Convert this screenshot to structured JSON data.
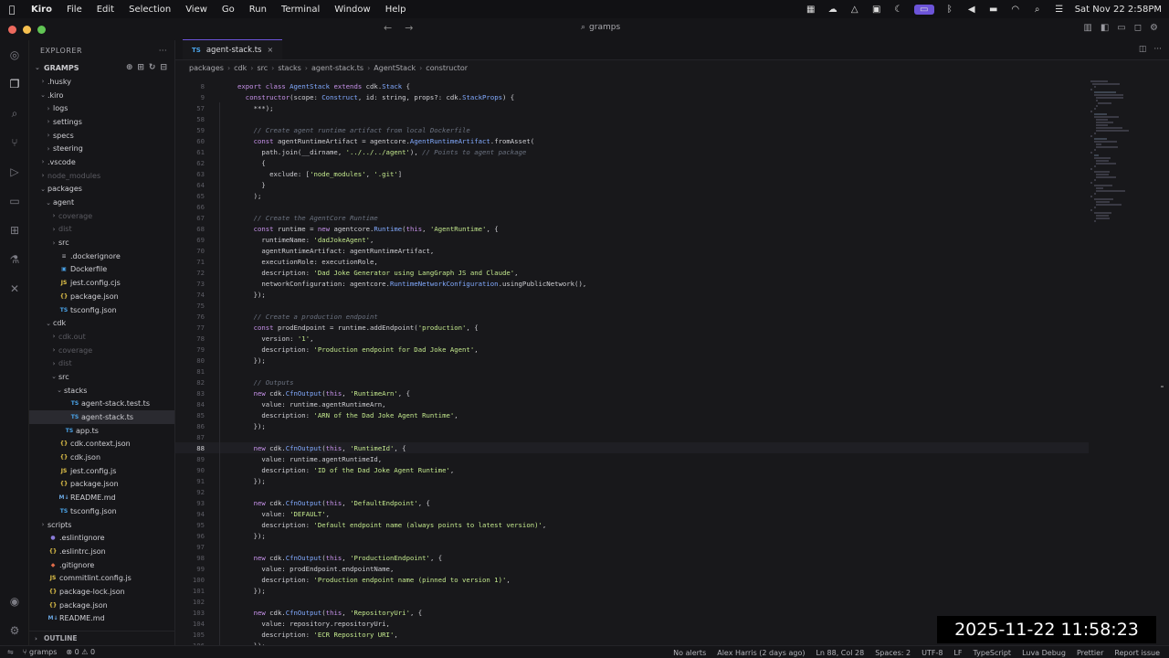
{
  "menubar": {
    "app_name": "Kiro",
    "menus": [
      "File",
      "Edit",
      "Selection",
      "View",
      "Go",
      "Run",
      "Terminal",
      "Window",
      "Help"
    ],
    "clock": "Sat Nov 22  2:58PM"
  },
  "titlebar": {
    "search_label": "gramps"
  },
  "sidebar": {
    "header": "EXPLORER",
    "root_label": "GRAMPS",
    "outline_label": "OUTLINE",
    "tree": [
      {
        "label": ".husky",
        "indent": 1,
        "chev": "›",
        "icon": "",
        "dim": false
      },
      {
        "label": ".kiro",
        "indent": 1,
        "chev": "⌄",
        "icon": "",
        "dim": false
      },
      {
        "label": "logs",
        "indent": 2,
        "chev": "›",
        "icon": "",
        "dim": false
      },
      {
        "label": "settings",
        "indent": 2,
        "chev": "›",
        "icon": "",
        "dim": false
      },
      {
        "label": "specs",
        "indent": 2,
        "chev": "›",
        "icon": "",
        "dim": false
      },
      {
        "label": "steering",
        "indent": 2,
        "chev": "›",
        "icon": "",
        "dim": false
      },
      {
        "label": ".vscode",
        "indent": 1,
        "chev": "›",
        "icon": "",
        "dim": false
      },
      {
        "label": "node_modules",
        "indent": 1,
        "chev": "›",
        "icon": "",
        "dim": true
      },
      {
        "label": "packages",
        "indent": 1,
        "chev": "⌄",
        "icon": "",
        "dim": false
      },
      {
        "label": "agent",
        "indent": 2,
        "chev": "⌄",
        "icon": "",
        "dim": false
      },
      {
        "label": "coverage",
        "indent": 3,
        "chev": "›",
        "icon": "",
        "dim": true
      },
      {
        "label": "dist",
        "indent": 3,
        "chev": "›",
        "icon": "",
        "dim": true
      },
      {
        "label": "src",
        "indent": 3,
        "chev": "›",
        "icon": "",
        "dim": false
      },
      {
        "label": ".dockerignore",
        "indent": 3,
        "chev": "",
        "icon": "≡",
        "dim": false
      },
      {
        "label": "Dockerfile",
        "indent": 3,
        "chev": "",
        "icon": "▣",
        "dim": false
      },
      {
        "label": "jest.config.cjs",
        "indent": 3,
        "chev": "",
        "icon": "JS",
        "dim": false
      },
      {
        "label": "package.json",
        "indent": 3,
        "chev": "",
        "icon": "{}",
        "dim": false
      },
      {
        "label": "tsconfig.json",
        "indent": 3,
        "chev": "",
        "icon": "TS",
        "dim": false
      },
      {
        "label": "cdk",
        "indent": 2,
        "chev": "⌄",
        "icon": "",
        "dim": false
      },
      {
        "label": "cdk.out",
        "indent": 3,
        "chev": "›",
        "icon": "",
        "dim": true
      },
      {
        "label": "coverage",
        "indent": 3,
        "chev": "›",
        "icon": "",
        "dim": true
      },
      {
        "label": "dist",
        "indent": 3,
        "chev": "›",
        "icon": "",
        "dim": true
      },
      {
        "label": "src",
        "indent": 3,
        "chev": "⌄",
        "icon": "",
        "dim": false
      },
      {
        "label": "stacks",
        "indent": 4,
        "chev": "⌄",
        "icon": "",
        "dim": false
      },
      {
        "label": "agent-stack.test.ts",
        "indent": 5,
        "chev": "",
        "icon": "TS",
        "dim": false
      },
      {
        "label": "agent-stack.ts",
        "indent": 5,
        "chev": "",
        "icon": "TS",
        "dim": false,
        "selected": true
      },
      {
        "label": "app.ts",
        "indent": 4,
        "chev": "",
        "icon": "TS",
        "dim": false
      },
      {
        "label": "cdk.context.json",
        "indent": 3,
        "chev": "",
        "icon": "{}",
        "dim": false
      },
      {
        "label": "cdk.json",
        "indent": 3,
        "chev": "",
        "icon": "{}",
        "dim": false
      },
      {
        "label": "jest.config.js",
        "indent": 3,
        "chev": "",
        "icon": "JS",
        "dim": false
      },
      {
        "label": "package.json",
        "indent": 3,
        "chev": "",
        "icon": "{}",
        "dim": false
      },
      {
        "label": "README.md",
        "indent": 3,
        "chev": "",
        "icon": "M↓",
        "dim": false
      },
      {
        "label": "tsconfig.json",
        "indent": 3,
        "chev": "",
        "icon": "TS",
        "dim": false
      },
      {
        "label": "scripts",
        "indent": 1,
        "chev": "›",
        "icon": "",
        "dim": false
      },
      {
        "label": ".eslintignore",
        "indent": 1,
        "chev": "",
        "icon": "●",
        "dim": false
      },
      {
        "label": ".eslintrc.json",
        "indent": 1,
        "chev": "",
        "icon": "{}",
        "dim": false
      },
      {
        "label": ".gitignore",
        "indent": 1,
        "chev": "",
        "icon": "◆",
        "dim": false
      },
      {
        "label": "commitlint.config.js",
        "indent": 1,
        "chev": "",
        "icon": "JS",
        "dim": false
      },
      {
        "label": "package-lock.json",
        "indent": 1,
        "chev": "",
        "icon": "{}",
        "dim": false
      },
      {
        "label": "package.json",
        "indent": 1,
        "chev": "",
        "icon": "{}",
        "dim": false
      },
      {
        "label": "README.md",
        "indent": 1,
        "chev": "",
        "icon": "M↓",
        "dim": false
      }
    ]
  },
  "editor": {
    "tab_label": "agent-stack.ts",
    "breadcrumb": [
      "packages",
      "cdk",
      "src",
      "stacks",
      "agent-stack.ts",
      "AgentStack",
      "constructor"
    ],
    "current_line": 88,
    "lines": [
      {
        "n": 8,
        "t": "export class AgentStack extends cdk.Stack {"
      },
      {
        "n": 9,
        "t": "  constructor(scope: Construct, id: string, props?: cdk.StackProps) {"
      },
      {
        "n": 57,
        "t": "    ***);"
      },
      {
        "n": 58,
        "t": ""
      },
      {
        "n": 59,
        "t": "    // Create agent runtime artifact from local Dockerfile"
      },
      {
        "n": 60,
        "t": "    const agentRuntimeArtifact = agentcore.AgentRuntimeArtifact.fromAsset("
      },
      {
        "n": 61,
        "t": "      path.join(__dirname, '../../../agent'), // Points to agent package"
      },
      {
        "n": 62,
        "t": "      {"
      },
      {
        "n": 63,
        "t": "        exclude: ['node_modules', '.git']"
      },
      {
        "n": 64,
        "t": "      }"
      },
      {
        "n": 65,
        "t": "    );"
      },
      {
        "n": 66,
        "t": ""
      },
      {
        "n": 67,
        "t": "    // Create the AgentCore Runtime"
      },
      {
        "n": 68,
        "t": "    const runtime = new agentcore.Runtime(this, 'AgentRuntime', {"
      },
      {
        "n": 69,
        "t": "      runtimeName: 'dadJokeAgent',"
      },
      {
        "n": 70,
        "t": "      agentRuntimeArtifact: agentRuntimeArtifact,"
      },
      {
        "n": 71,
        "t": "      executionRole: executionRole,"
      },
      {
        "n": 72,
        "t": "      description: 'Dad Joke Generator using LangGraph JS and Claude',"
      },
      {
        "n": 73,
        "t": "      networkConfiguration: agentcore.RuntimeNetworkConfiguration.usingPublicNetwork(),"
      },
      {
        "n": 74,
        "t": "    });"
      },
      {
        "n": 75,
        "t": ""
      },
      {
        "n": 76,
        "t": "    // Create a production endpoint"
      },
      {
        "n": 77,
        "t": "    const prodEndpoint = runtime.addEndpoint('production', {"
      },
      {
        "n": 78,
        "t": "      version: '1',"
      },
      {
        "n": 79,
        "t": "      description: 'Production endpoint for Dad Joke Agent',"
      },
      {
        "n": 80,
        "t": "    });"
      },
      {
        "n": 81,
        "t": ""
      },
      {
        "n": 82,
        "t": "    // Outputs"
      },
      {
        "n": 83,
        "t": "    new cdk.CfnOutput(this, 'RuntimeArn', {"
      },
      {
        "n": 84,
        "t": "      value: runtime.agentRuntimeArn,"
      },
      {
        "n": 85,
        "t": "      description: 'ARN of the Dad Joke Agent Runtime',"
      },
      {
        "n": 86,
        "t": "    });"
      },
      {
        "n": 87,
        "t": ""
      },
      {
        "n": 88,
        "t": "    new cdk.CfnOutput(this, 'RuntimeId', {"
      },
      {
        "n": 89,
        "t": "      value: runtime.agentRuntimeId,"
      },
      {
        "n": 90,
        "t": "      description: 'ID of the Dad Joke Agent Runtime',"
      },
      {
        "n": 91,
        "t": "    });"
      },
      {
        "n": 92,
        "t": ""
      },
      {
        "n": 93,
        "t": "    new cdk.CfnOutput(this, 'DefaultEndpoint', {"
      },
      {
        "n": 94,
        "t": "      value: 'DEFAULT',"
      },
      {
        "n": 95,
        "t": "      description: 'Default endpoint name (always points to latest version)',"
      },
      {
        "n": 96,
        "t": "    });"
      },
      {
        "n": 97,
        "t": ""
      },
      {
        "n": 98,
        "t": "    new cdk.CfnOutput(this, 'ProductionEndpoint', {"
      },
      {
        "n": 99,
        "t": "      value: prodEndpoint.endpointName,"
      },
      {
        "n": 100,
        "t": "      description: 'Production endpoint name (pinned to version 1)',"
      },
      {
        "n": 101,
        "t": "    });"
      },
      {
        "n": 102,
        "t": ""
      },
      {
        "n": 103,
        "t": "    new cdk.CfnOutput(this, 'RepositoryUri', {"
      },
      {
        "n": 104,
        "t": "      value: repository.repositoryUri,"
      },
      {
        "n": 105,
        "t": "      description: 'ECR Repository URI',"
      },
      {
        "n": 106,
        "t": "    });"
      }
    ]
  },
  "statusbar": {
    "branch": "gramps",
    "problems": "⊗ 0  ⚠ 0",
    "alerts": "No alerts",
    "blame": "Alex Harris (2 days ago)",
    "cursor": "Ln 88, Col 28",
    "spaces": "Spaces: 2",
    "encoding": "UTF-8",
    "eol": "LF",
    "language": "TypeScript",
    "debug": "Luva Debug",
    "formatter": "Prettier",
    "report": "Report issue"
  },
  "overlay": {
    "timestamp": "2025-11-22 11:58:23"
  },
  "colors": {
    "accent": "#6c54d8",
    "keyword": "#c792ea",
    "string": "#c3e88d",
    "comment": "#6b7280",
    "type": "#82aaff",
    "ts_icon": "#4aa3e8",
    "js_icon": "#e8c84a",
    "json_icon": "#e8c84a"
  }
}
